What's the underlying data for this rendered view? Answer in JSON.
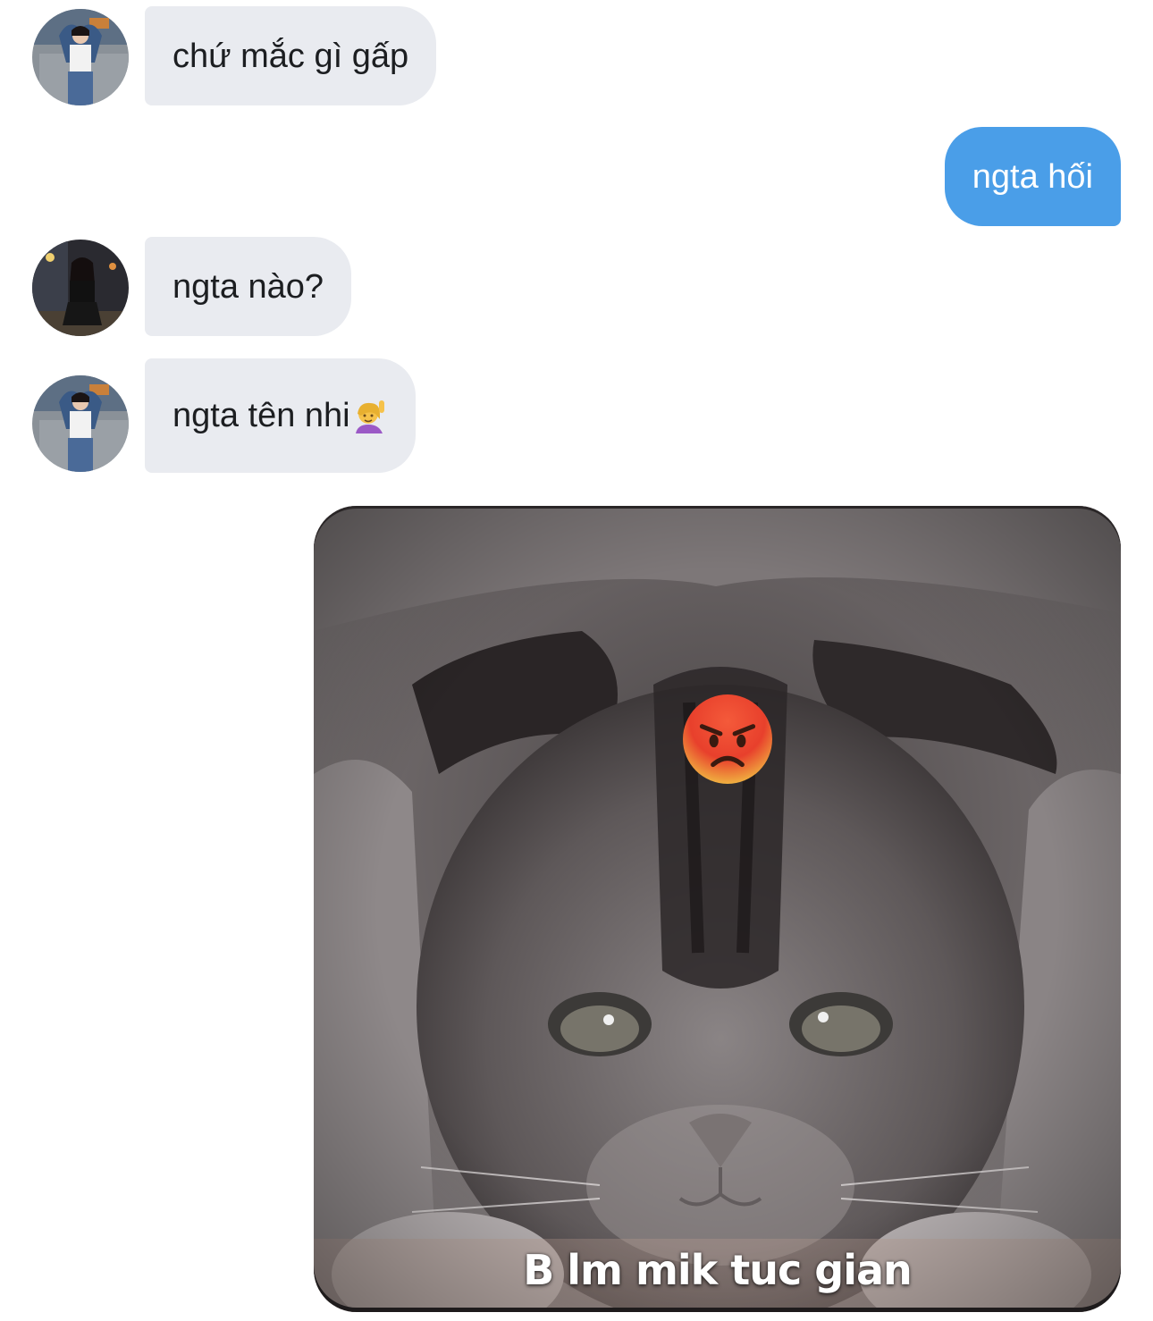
{
  "conversation": {
    "messages": [
      {
        "sender": "contact",
        "text": "chứ mắc gì gấp"
      },
      {
        "sender": "me",
        "text": "ngta hối"
      },
      {
        "sender": "contact",
        "text": "ngta nào?"
      },
      {
        "sender": "contact",
        "text": "ngta tên nhi",
        "emoji": "person-raising-hand-emoji"
      },
      {
        "sender": "me",
        "type": "sticker",
        "sticker_caption": "B lm mik tuc gian",
        "sticker_emoji": "angry-face-emoji",
        "sticker_subject": "grey-kitten"
      }
    ]
  },
  "colors": {
    "incoming_bubble": "#e9ebf0",
    "outgoing_bubble": "#4a9ee8",
    "incoming_text": "#1c1e21",
    "outgoing_text": "#ffffff"
  }
}
